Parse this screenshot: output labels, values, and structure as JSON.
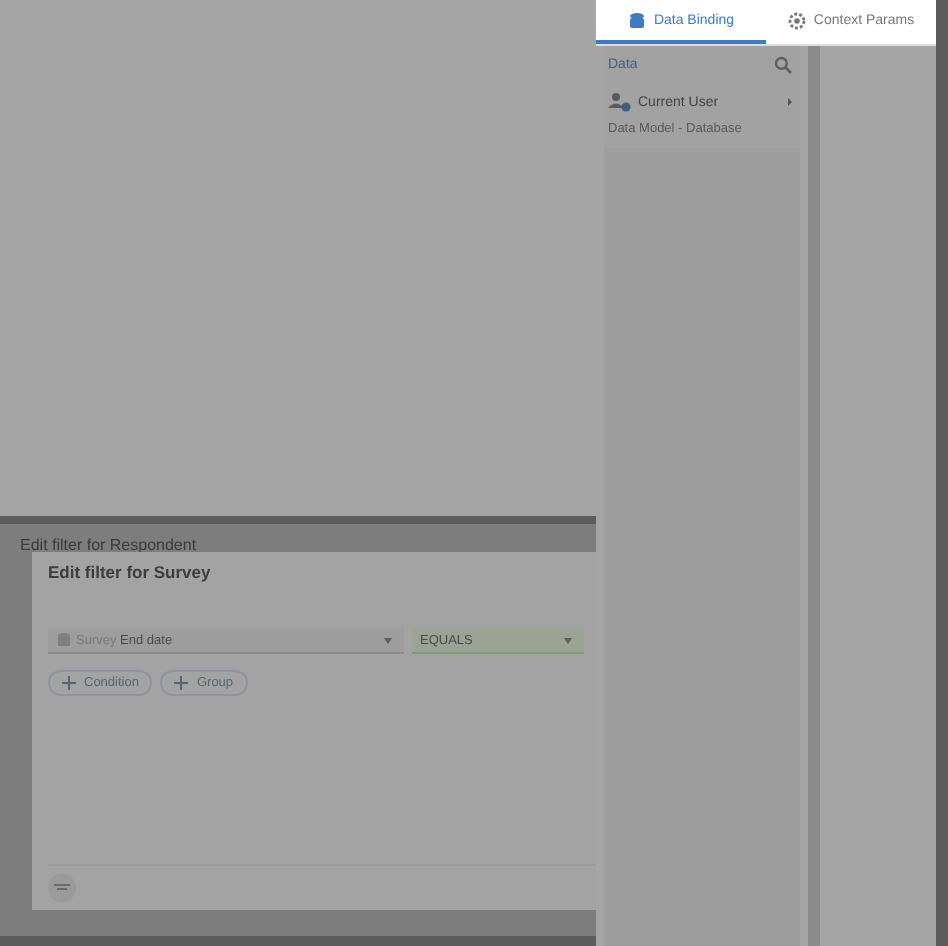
{
  "background_dialog": {
    "title": "Edit filter for Respondent"
  },
  "dialog": {
    "title": "Edit filter for Survey",
    "field": {
      "prefix": "Survey",
      "value": "End date"
    },
    "operator": {
      "value": "EQUALS"
    },
    "buttons": [
      {
        "label": "Condition"
      },
      {
        "label": "Group"
      }
    ]
  },
  "panel": {
    "tabs": [
      {
        "label": "Data Binding",
        "selected": true
      },
      {
        "label": "Context Params",
        "selected": false
      }
    ],
    "section": "Data",
    "items": [
      {
        "label": "Current User",
        "expanded": false
      }
    ],
    "subheading": "Data Model - Database"
  }
}
